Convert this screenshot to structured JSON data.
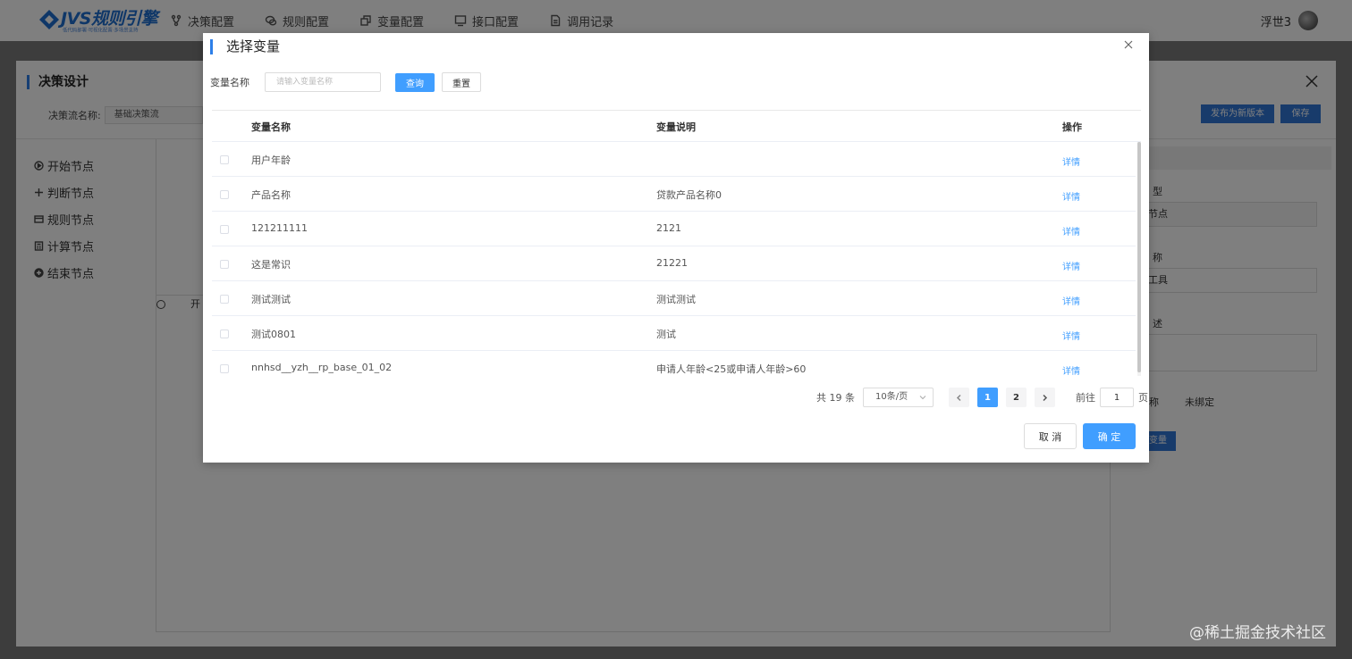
{
  "app": {
    "logo_text": "JVS规则引擎",
    "logo_subtitle": "低代码部署·可视化配置·多场景支持",
    "nav": [
      {
        "label": "决策配置",
        "icon": "branch-icon"
      },
      {
        "label": "规则配置",
        "icon": "chat-icon"
      },
      {
        "label": "变量配置",
        "icon": "copy-icon"
      },
      {
        "label": "接口配置",
        "icon": "monitor-icon"
      },
      {
        "label": "调用记录",
        "icon": "document-icon"
      }
    ],
    "user_name": "浮世3"
  },
  "workspace": {
    "title": "决策设计",
    "flow_name_label": "决策流名称:",
    "flow_name_value": "基础决策流",
    "publish_label": "发布为新版本",
    "save_label": "保存",
    "palette": [
      {
        "label": "开始节点",
        "icon": "play-circle-icon"
      },
      {
        "label": "判断节点",
        "icon": "move-icon"
      },
      {
        "label": "规则节点",
        "icon": "card-icon"
      },
      {
        "label": "计算节点",
        "icon": "calculator-icon"
      },
      {
        "label": "结束节点",
        "icon": "plus-circle-icon"
      }
    ],
    "canvas_node_label": "开",
    "side_panel": {
      "type_label": "型",
      "type_value": "节点",
      "name_label": "称",
      "name_value": "工具",
      "desc_label": "述",
      "binding_label": "称",
      "binding_value": "未绑定",
      "variable_button": "变量"
    }
  },
  "modal": {
    "title": "选择变量",
    "search_label": "变量名称",
    "search_value": "",
    "search_placeholder": "请输入变量名称",
    "query_button": "查询",
    "reset_button": "重置",
    "columns": [
      "变量名称",
      "变量说明",
      "操作"
    ],
    "rows": [
      {
        "name": "用户年龄",
        "desc": "",
        "action": "详情"
      },
      {
        "name": "产品名称",
        "desc": "贷款产品名称0",
        "action": "详情"
      },
      {
        "name": "121211111",
        "desc": "2121",
        "action": "详情"
      },
      {
        "name": "这是常识",
        "desc": "21221",
        "action": "详情"
      },
      {
        "name": "测试测试",
        "desc": "测试测试",
        "action": "详情"
      },
      {
        "name": "测试0801",
        "desc": "测试",
        "action": "详情"
      },
      {
        "name": "nnhsd__yzh__rp_base_01_02",
        "desc": "申请人年龄<25或申请人年龄>60",
        "action": "详情"
      }
    ],
    "pagination": {
      "total_text": "共 19 条",
      "page_size": "10条/页",
      "pages": [
        "1",
        "2"
      ],
      "current_page": "1",
      "goto_label": "前往",
      "goto_value": "1",
      "goto_unit": "页"
    },
    "cancel_button": "取 消",
    "confirm_button": "确 定"
  },
  "watermark": "@稀土掘金技术社区",
  "colors": {
    "primary": "#409eff",
    "brand": "#3177d6",
    "accent_bar": "#2d7fe8"
  }
}
